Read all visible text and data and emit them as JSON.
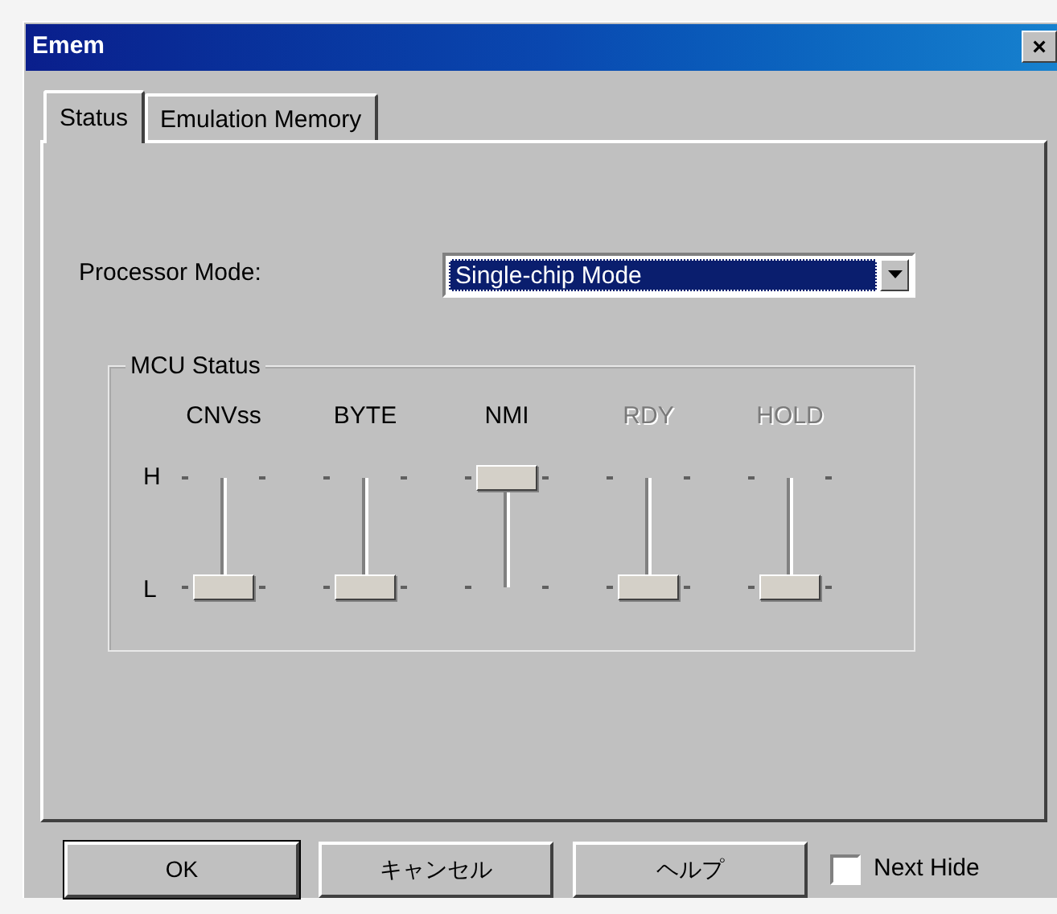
{
  "window": {
    "title": "Emem",
    "close": "×"
  },
  "tabs": [
    {
      "label": "Status",
      "selected": true
    },
    {
      "label": "Emulation Memory",
      "selected": false
    }
  ],
  "processor_mode": {
    "label": "Processor Mode:",
    "value": "Single-chip Mode"
  },
  "mcu_status": {
    "title": "MCU Status",
    "high_label": "H",
    "low_label": "L",
    "signals": [
      {
        "name": "CNVss",
        "disabled": false,
        "level": 0
      },
      {
        "name": "BYTE",
        "disabled": false,
        "level": 0
      },
      {
        "name": "NMI",
        "disabled": false,
        "level": 1
      },
      {
        "name": "RDY",
        "disabled": true,
        "level": 0
      },
      {
        "name": "HOLD",
        "disabled": true,
        "level": 0
      }
    ]
  },
  "buttons": [
    {
      "label": "OK",
      "default": true
    },
    {
      "label": "キャンセル",
      "default": false
    },
    {
      "label": "ヘルプ",
      "default": false
    }
  ],
  "next_hide": {
    "label": "Next Hide",
    "checked": false
  }
}
